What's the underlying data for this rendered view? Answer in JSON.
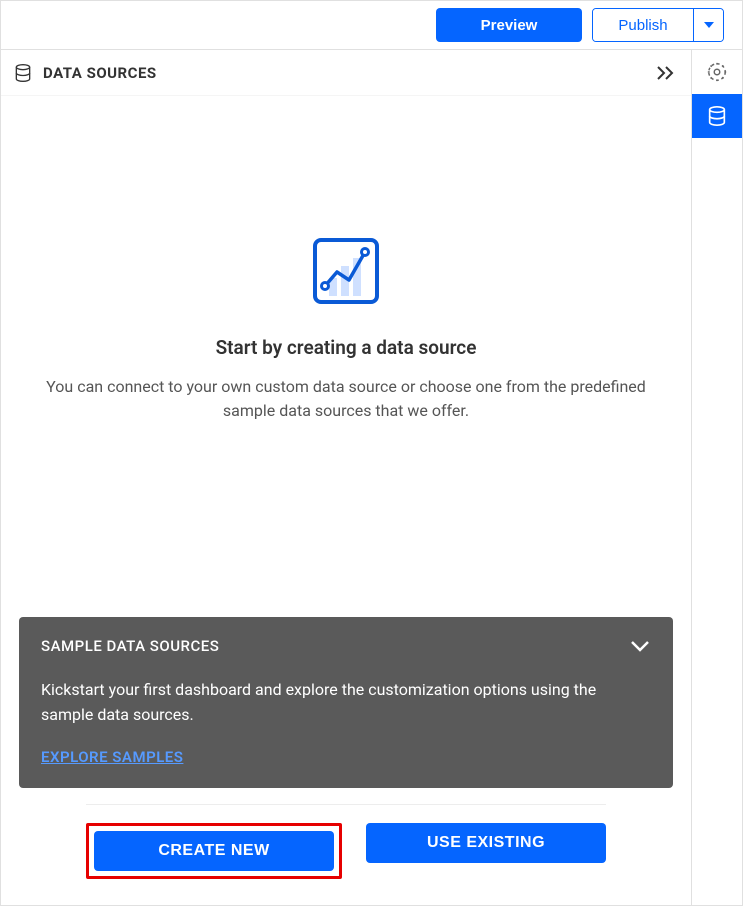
{
  "topbar": {
    "preview_label": "Preview",
    "publish_label": "Publish"
  },
  "panel": {
    "title": "DATA SOURCES"
  },
  "empty": {
    "title": "Start by creating a data source",
    "description": "You can connect to your own custom data source or choose one from the predefined sample data sources that we offer."
  },
  "sample": {
    "title": "SAMPLE DATA SOURCES",
    "description": "Kickstart your first dashboard and explore the customization options using the sample data sources.",
    "link_label": "EXPLORE SAMPLES"
  },
  "actions": {
    "create_new": "CREATE NEW",
    "use_existing": "USE EXISTING"
  }
}
